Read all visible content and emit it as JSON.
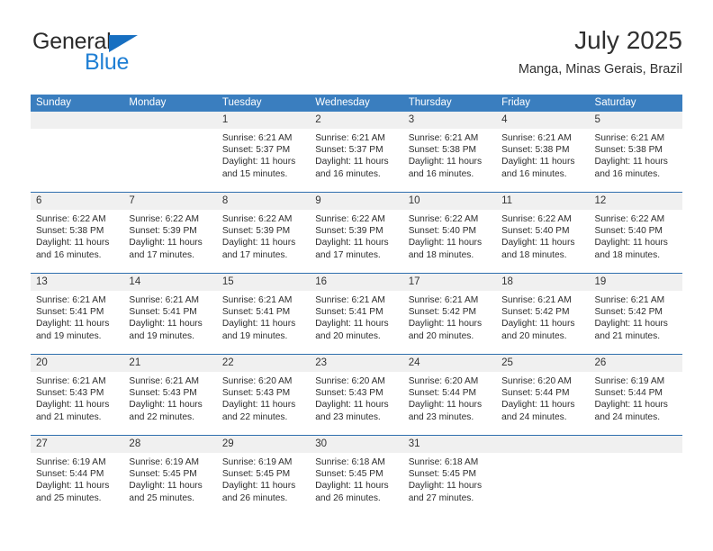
{
  "brand": {
    "name_part1": "General",
    "name_part2": "Blue",
    "accent_color": "#1f7fd4",
    "triangle_icon": "brand-triangle-icon"
  },
  "header": {
    "title": "July 2025",
    "subtitle": "Manga, Minas Gerais, Brazil"
  },
  "calendar": {
    "header_color": "#3a7ebf",
    "weekday_headers": [
      "Sunday",
      "Monday",
      "Tuesday",
      "Wednesday",
      "Thursday",
      "Friday",
      "Saturday"
    ],
    "weeks": [
      [
        {
          "day": "",
          "sunrise": "",
          "sunset": "",
          "daylight": "",
          "daylight2": "",
          "empty": true
        },
        {
          "day": "",
          "sunrise": "",
          "sunset": "",
          "daylight": "",
          "daylight2": "",
          "empty": true
        },
        {
          "day": "1",
          "sunrise": "Sunrise: 6:21 AM",
          "sunset": "Sunset: 5:37 PM",
          "daylight": "Daylight: 11 hours",
          "daylight2": "and 15 minutes."
        },
        {
          "day": "2",
          "sunrise": "Sunrise: 6:21 AM",
          "sunset": "Sunset: 5:37 PM",
          "daylight": "Daylight: 11 hours",
          "daylight2": "and 16 minutes."
        },
        {
          "day": "3",
          "sunrise": "Sunrise: 6:21 AM",
          "sunset": "Sunset: 5:38 PM",
          "daylight": "Daylight: 11 hours",
          "daylight2": "and 16 minutes."
        },
        {
          "day": "4",
          "sunrise": "Sunrise: 6:21 AM",
          "sunset": "Sunset: 5:38 PM",
          "daylight": "Daylight: 11 hours",
          "daylight2": "and 16 minutes."
        },
        {
          "day": "5",
          "sunrise": "Sunrise: 6:21 AM",
          "sunset": "Sunset: 5:38 PM",
          "daylight": "Daylight: 11 hours",
          "daylight2": "and 16 minutes."
        }
      ],
      [
        {
          "day": "6",
          "sunrise": "Sunrise: 6:22 AM",
          "sunset": "Sunset: 5:38 PM",
          "daylight": "Daylight: 11 hours",
          "daylight2": "and 16 minutes."
        },
        {
          "day": "7",
          "sunrise": "Sunrise: 6:22 AM",
          "sunset": "Sunset: 5:39 PM",
          "daylight": "Daylight: 11 hours",
          "daylight2": "and 17 minutes."
        },
        {
          "day": "8",
          "sunrise": "Sunrise: 6:22 AM",
          "sunset": "Sunset: 5:39 PM",
          "daylight": "Daylight: 11 hours",
          "daylight2": "and 17 minutes."
        },
        {
          "day": "9",
          "sunrise": "Sunrise: 6:22 AM",
          "sunset": "Sunset: 5:39 PM",
          "daylight": "Daylight: 11 hours",
          "daylight2": "and 17 minutes."
        },
        {
          "day": "10",
          "sunrise": "Sunrise: 6:22 AM",
          "sunset": "Sunset: 5:40 PM",
          "daylight": "Daylight: 11 hours",
          "daylight2": "and 18 minutes."
        },
        {
          "day": "11",
          "sunrise": "Sunrise: 6:22 AM",
          "sunset": "Sunset: 5:40 PM",
          "daylight": "Daylight: 11 hours",
          "daylight2": "and 18 minutes."
        },
        {
          "day": "12",
          "sunrise": "Sunrise: 6:22 AM",
          "sunset": "Sunset: 5:40 PM",
          "daylight": "Daylight: 11 hours",
          "daylight2": "and 18 minutes."
        }
      ],
      [
        {
          "day": "13",
          "sunrise": "Sunrise: 6:21 AM",
          "sunset": "Sunset: 5:41 PM",
          "daylight": "Daylight: 11 hours",
          "daylight2": "and 19 minutes."
        },
        {
          "day": "14",
          "sunrise": "Sunrise: 6:21 AM",
          "sunset": "Sunset: 5:41 PM",
          "daylight": "Daylight: 11 hours",
          "daylight2": "and 19 minutes."
        },
        {
          "day": "15",
          "sunrise": "Sunrise: 6:21 AM",
          "sunset": "Sunset: 5:41 PM",
          "daylight": "Daylight: 11 hours",
          "daylight2": "and 19 minutes."
        },
        {
          "day": "16",
          "sunrise": "Sunrise: 6:21 AM",
          "sunset": "Sunset: 5:41 PM",
          "daylight": "Daylight: 11 hours",
          "daylight2": "and 20 minutes."
        },
        {
          "day": "17",
          "sunrise": "Sunrise: 6:21 AM",
          "sunset": "Sunset: 5:42 PM",
          "daylight": "Daylight: 11 hours",
          "daylight2": "and 20 minutes."
        },
        {
          "day": "18",
          "sunrise": "Sunrise: 6:21 AM",
          "sunset": "Sunset: 5:42 PM",
          "daylight": "Daylight: 11 hours",
          "daylight2": "and 20 minutes."
        },
        {
          "day": "19",
          "sunrise": "Sunrise: 6:21 AM",
          "sunset": "Sunset: 5:42 PM",
          "daylight": "Daylight: 11 hours",
          "daylight2": "and 21 minutes."
        }
      ],
      [
        {
          "day": "20",
          "sunrise": "Sunrise: 6:21 AM",
          "sunset": "Sunset: 5:43 PM",
          "daylight": "Daylight: 11 hours",
          "daylight2": "and 21 minutes."
        },
        {
          "day": "21",
          "sunrise": "Sunrise: 6:21 AM",
          "sunset": "Sunset: 5:43 PM",
          "daylight": "Daylight: 11 hours",
          "daylight2": "and 22 minutes."
        },
        {
          "day": "22",
          "sunrise": "Sunrise: 6:20 AM",
          "sunset": "Sunset: 5:43 PM",
          "daylight": "Daylight: 11 hours",
          "daylight2": "and 22 minutes."
        },
        {
          "day": "23",
          "sunrise": "Sunrise: 6:20 AM",
          "sunset": "Sunset: 5:43 PM",
          "daylight": "Daylight: 11 hours",
          "daylight2": "and 23 minutes."
        },
        {
          "day": "24",
          "sunrise": "Sunrise: 6:20 AM",
          "sunset": "Sunset: 5:44 PM",
          "daylight": "Daylight: 11 hours",
          "daylight2": "and 23 minutes."
        },
        {
          "day": "25",
          "sunrise": "Sunrise: 6:20 AM",
          "sunset": "Sunset: 5:44 PM",
          "daylight": "Daylight: 11 hours",
          "daylight2": "and 24 minutes."
        },
        {
          "day": "26",
          "sunrise": "Sunrise: 6:19 AM",
          "sunset": "Sunset: 5:44 PM",
          "daylight": "Daylight: 11 hours",
          "daylight2": "and 24 minutes."
        }
      ],
      [
        {
          "day": "27",
          "sunrise": "Sunrise: 6:19 AM",
          "sunset": "Sunset: 5:44 PM",
          "daylight": "Daylight: 11 hours",
          "daylight2": "and 25 minutes."
        },
        {
          "day": "28",
          "sunrise": "Sunrise: 6:19 AM",
          "sunset": "Sunset: 5:45 PM",
          "daylight": "Daylight: 11 hours",
          "daylight2": "and 25 minutes."
        },
        {
          "day": "29",
          "sunrise": "Sunrise: 6:19 AM",
          "sunset": "Sunset: 5:45 PM",
          "daylight": "Daylight: 11 hours",
          "daylight2": "and 26 minutes."
        },
        {
          "day": "30",
          "sunrise": "Sunrise: 6:18 AM",
          "sunset": "Sunset: 5:45 PM",
          "daylight": "Daylight: 11 hours",
          "daylight2": "and 26 minutes."
        },
        {
          "day": "31",
          "sunrise": "Sunrise: 6:18 AM",
          "sunset": "Sunset: 5:45 PM",
          "daylight": "Daylight: 11 hours",
          "daylight2": "and 27 minutes."
        },
        {
          "day": "",
          "sunrise": "",
          "sunset": "",
          "daylight": "",
          "daylight2": "",
          "empty": true
        },
        {
          "day": "",
          "sunrise": "",
          "sunset": "",
          "daylight": "",
          "daylight2": "",
          "empty": true
        }
      ]
    ]
  }
}
